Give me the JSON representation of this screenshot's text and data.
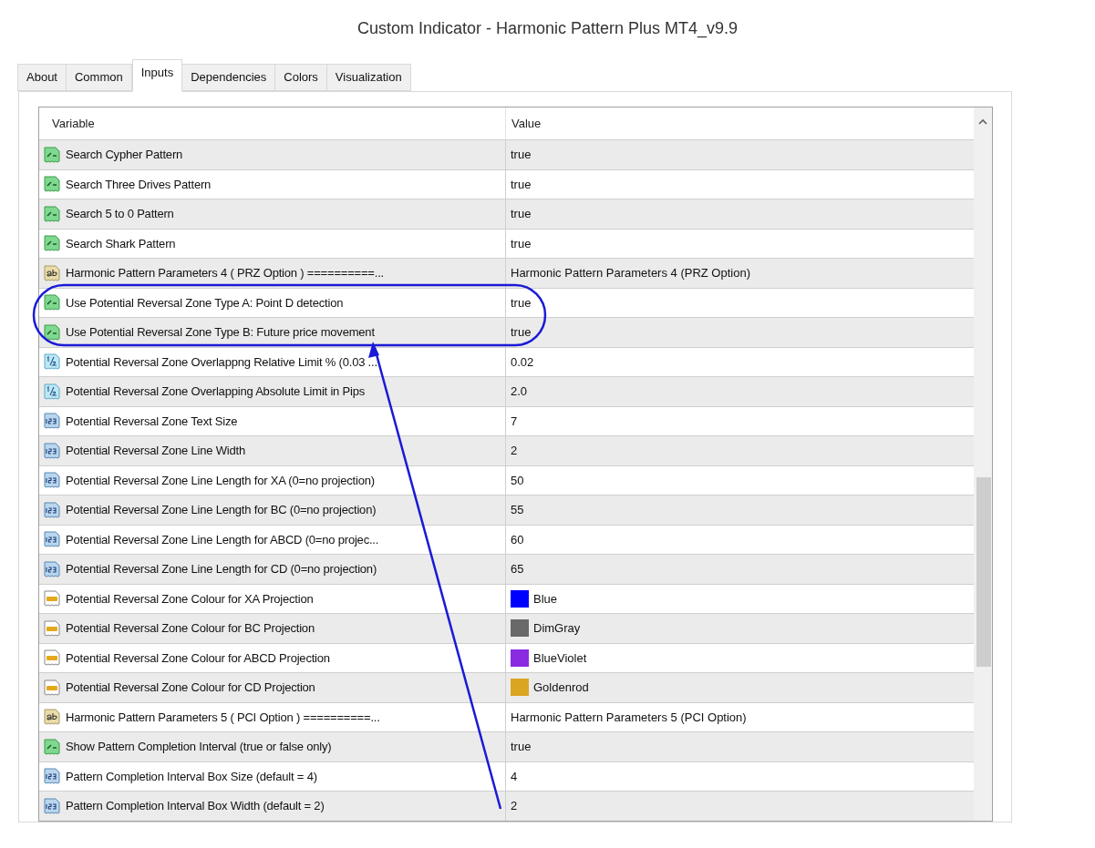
{
  "window": {
    "title": "Custom Indicator - Harmonic Pattern Plus MT4_v9.9"
  },
  "tabs": [
    {
      "label": "About",
      "selected": false
    },
    {
      "label": "Common",
      "selected": false
    },
    {
      "label": "Inputs",
      "selected": true
    },
    {
      "label": "Dependencies",
      "selected": false
    },
    {
      "label": "Colors",
      "selected": false
    },
    {
      "label": "Visualization",
      "selected": false
    }
  ],
  "table": {
    "columns": [
      "Variable",
      "Value"
    ],
    "rows": [
      {
        "kind": "bool",
        "variable": "Search Cypher Pattern",
        "value": "true"
      },
      {
        "kind": "bool",
        "variable": "Search Three Drives Pattern",
        "value": "true"
      },
      {
        "kind": "bool",
        "variable": "Search 5 to 0 Pattern",
        "value": "true"
      },
      {
        "kind": "bool",
        "variable": "Search Shark Pattern",
        "value": "true"
      },
      {
        "kind": "string",
        "variable": "Harmonic  Pattern Parameters 4 ( PRZ Option ) ==========...",
        "value": "Harmonic Pattern Parameters 4 (PRZ Option)"
      },
      {
        "kind": "bool",
        "variable": "Use Potential Reversal Zone Type A: Point D detection",
        "value": "true"
      },
      {
        "kind": "bool",
        "variable": "Use Potential Reversal Zone Type B: Future price movement",
        "value": "true"
      },
      {
        "kind": "double",
        "variable": "Potential Reversal Zone Overlappng Relative Limit %  (0.03 ...",
        "value": "0.02"
      },
      {
        "kind": "double",
        "variable": "Potential Reversal Zone Overlapping Absolute Limit in Pips",
        "value": "2.0"
      },
      {
        "kind": "int",
        "variable": "Potential Reversal Zone Text Size",
        "value": "7"
      },
      {
        "kind": "int",
        "variable": "Potential Reversal Zone Line Width",
        "value": "2"
      },
      {
        "kind": "int",
        "variable": "Potential Reversal Zone Line Length for XA (0=no projection)",
        "value": "50"
      },
      {
        "kind": "int",
        "variable": "Potential Reversal Zone Line Length for BC (0=no projection)",
        "value": "55"
      },
      {
        "kind": "int",
        "variable": "Potential Reversal Zone Line Length for ABCD (0=no projec...",
        "value": "60"
      },
      {
        "kind": "int",
        "variable": "Potential Reversal Zone Line Length for CD (0=no projection)",
        "value": "65"
      },
      {
        "kind": "color",
        "variable": "Potential Reversal Zone Colour for XA Projection",
        "value": "Blue",
        "color": "#0000ff"
      },
      {
        "kind": "color",
        "variable": "Potential Reversal Zone Colour for BC Projection",
        "value": "DimGray",
        "color": "#696969"
      },
      {
        "kind": "color",
        "variable": "Potential Reversal Zone Colour for ABCD Projection",
        "value": "BlueViolet",
        "color": "#8a2be2"
      },
      {
        "kind": "color",
        "variable": "Potential Reversal Zone Colour for CD Projection",
        "value": "Goldenrod",
        "color": "#daa520"
      },
      {
        "kind": "string",
        "variable": "Harmonic  Pattern Parameters 5 ( PCI Option ) ==========...",
        "value": "Harmonic Pattern Parameters 5 (PCI Option)"
      },
      {
        "kind": "bool",
        "variable": "Show Pattern Completion Interval (true or false only)",
        "value": "true"
      },
      {
        "kind": "int",
        "variable": "Pattern Completion Interval Box Size (default = 4)",
        "value": "4"
      },
      {
        "kind": "int",
        "variable": "Pattern Completion Interval Box Width (default = 2)",
        "value": "2"
      }
    ]
  }
}
